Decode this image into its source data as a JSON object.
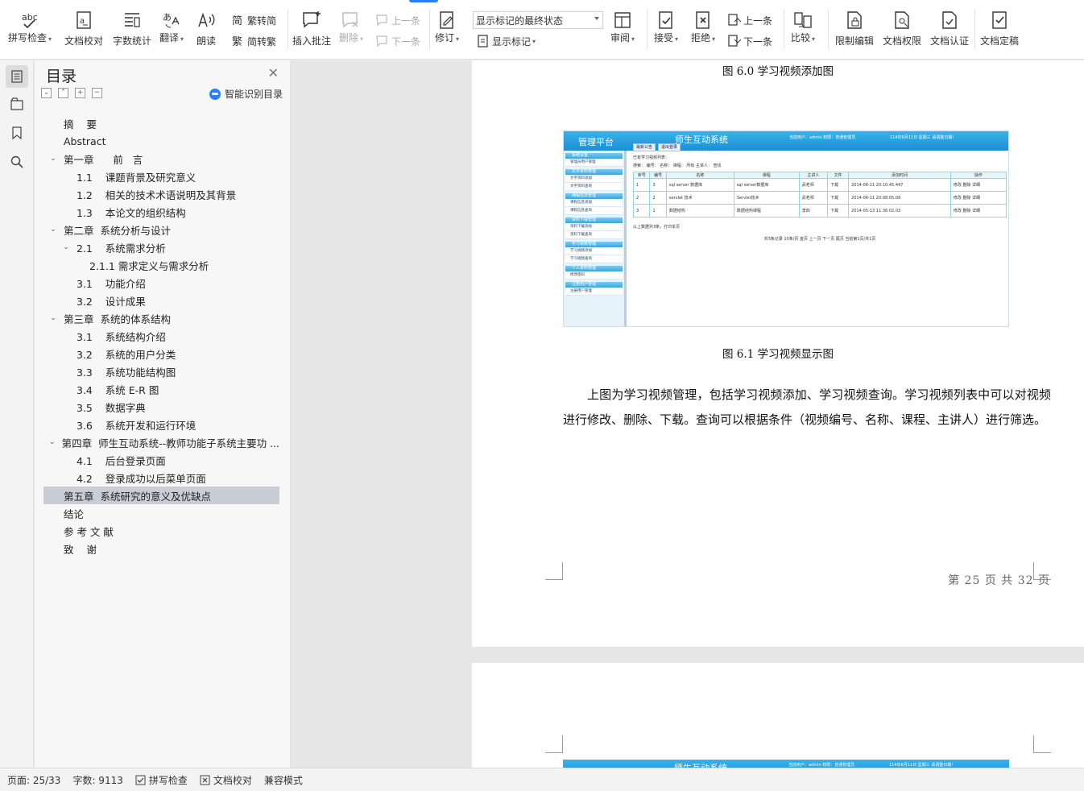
{
  "toolbar": {
    "spellcheck": "拼写检查",
    "proofread": "文档校对",
    "wordcount": "字数统计",
    "translate": "翻译",
    "read_aloud": "朗读",
    "trad_to_simp": "繁转简",
    "simp_to_trad": "简转繁",
    "insert_comment": "插入批注",
    "delete": "删除",
    "prev_comment": "上一条",
    "next_comment": "下一条",
    "track_changes": "修订",
    "markup_state": "显示标记的最终状态",
    "show_markup": "显示标记",
    "review": "审阅",
    "accept": "接受",
    "reject": "拒绝",
    "prev_change": "上一条",
    "next_change": "下一条",
    "compare": "比较",
    "restrict_editing": "限制编辑",
    "doc_permissions": "文档权限",
    "doc_certify": "文档认证",
    "doc_finalize": "文档定稿"
  },
  "toc": {
    "title": "目录",
    "smart_recognize": "智能识别目录",
    "items": [
      {
        "text": "摘    要",
        "level": 0,
        "chev": ""
      },
      {
        "text": "Abstract",
        "level": 0,
        "chev": ""
      },
      {
        "text": "第一章      前   言",
        "level": 0,
        "chev": "v"
      },
      {
        "text": "1.1    课题背景及研究意义",
        "level": 1,
        "chev": ""
      },
      {
        "text": "1.2    相关的技术术语说明及其背景",
        "level": 1,
        "chev": ""
      },
      {
        "text": "1.3    本论文的组织结构",
        "level": 1,
        "chev": ""
      },
      {
        "text": "第二章  系统分析与设计",
        "level": 0,
        "chev": "v"
      },
      {
        "text": "2.1    系统需求分析",
        "level": 1,
        "chev": "v"
      },
      {
        "text": "2.1.1 需求定义与需求分析",
        "level": 2,
        "chev": ""
      },
      {
        "text": "3.1    功能介绍",
        "level": 1,
        "chev": ""
      },
      {
        "text": "3.2    设计成果",
        "level": 1,
        "chev": ""
      },
      {
        "text": "第三章  系统的体系结构",
        "level": 0,
        "chev": "v"
      },
      {
        "text": "3.1    系统结构介绍",
        "level": 1,
        "chev": ""
      },
      {
        "text": "3.2    系统的用户分类",
        "level": 1,
        "chev": ""
      },
      {
        "text": "3.3    系统功能结构图",
        "level": 1,
        "chev": ""
      },
      {
        "text": "3.4    系统 E-R 图",
        "level": 1,
        "chev": ""
      },
      {
        "text": "3.5    数据字典",
        "level": 1,
        "chev": ""
      },
      {
        "text": "3.6    系统开发和运行环境",
        "level": 1,
        "chev": ""
      },
      {
        "text": "第四章  师生互动系统--教师功能子系统主要功 ...",
        "level": 0,
        "chev": "v"
      },
      {
        "text": "4.1    后台登录页面",
        "level": 1,
        "chev": ""
      },
      {
        "text": "4.2    登录成功以后菜单页面",
        "level": 1,
        "chev": ""
      },
      {
        "text": "第五章  系统研究的意义及优缺点",
        "level": 0,
        "chev": "",
        "selected": true
      },
      {
        "text": "结论",
        "level": 0,
        "chev": ""
      },
      {
        "text": "参 考 文 献",
        "level": 0,
        "chev": ""
      },
      {
        "text": "致    谢",
        "level": 0,
        "chev": ""
      }
    ]
  },
  "doc": {
    "caption_top": "图 6.0  学习视频添加图",
    "caption_fig": "图 6.1  学习视频显示图",
    "paragraph": "上图为学习视频管理，包括学习视频添加、学习视频查询。学习视频列表中可以对视频进行修改、删除、下载。查询可以根据条件（视频编号、名称、课程、主讲人）进行筛选。",
    "page_footer": "第  25  页  共  32  页"
  },
  "figure": {
    "platform": "管理平台",
    "system": "师生互动系统",
    "current_user": "当前用户：admin  权限：普通管理员",
    "date": "114年6月11日 星期三   请调整日期!",
    "tabs": [
      "最新公告",
      "退出登录"
    ],
    "menu": [
      {
        "head": "系统设置",
        "items": [
          "管理员用户管理"
        ]
      },
      {
        "head": "文字资料管理",
        "items": [
          "文字资料添加",
          "文字资料查询"
        ]
      },
      {
        "head": "课程信息管理",
        "items": [
          "课程信息添加",
          "课程信息查询"
        ]
      },
      {
        "head": "资料下载管理",
        "items": [
          "资料下载添加",
          "资料下载查询"
        ]
      },
      {
        "head": "学习视频管理",
        "items": [
          "学习视频添加",
          "学习视频查询"
        ]
      },
      {
        "head": "个人资料管理",
        "items": [
          "修改密码"
        ]
      },
      {
        "head": "注册用户管理",
        "items": [
          "注册用户管理"
        ]
      }
    ],
    "list_title": "已有学习视频列表：",
    "search_row": "搜索：  编号：              名称：              课程： 所有              主讲人：             查找",
    "headers": [
      "序号",
      "编号",
      "名称",
      "课程",
      "主讲人",
      "文件",
      "添加时间",
      "操作"
    ],
    "rows": [
      [
        "1",
        "3",
        "sql server 数据库",
        "sql server数据库",
        "武老师",
        "下载",
        "2014-06-11 20:10:45.447",
        "修改  删除  详细"
      ],
      [
        "2",
        "2",
        "servlet 技术",
        "Servlet技术",
        "武老师",
        "下载",
        "2014-06-11 20:08:05.09",
        "修改  删除  详细"
      ],
      [
        "3",
        "1",
        "数据结构",
        "数据结构课程",
        "李四",
        "下载",
        "2014-05-13 11:36:02.03",
        "修改  删除  详细"
      ]
    ],
    "total": "以上数据共3条，打印本页",
    "pager": "共3条记录   10条/页   首页   上一页   下一页   尾页   当前第1页/共1页"
  },
  "status": {
    "page": "页面: 25/33",
    "words": "字数: 9113",
    "spellcheck": "拼写检查",
    "proofread": "文档校对",
    "compat": "兼容模式"
  }
}
